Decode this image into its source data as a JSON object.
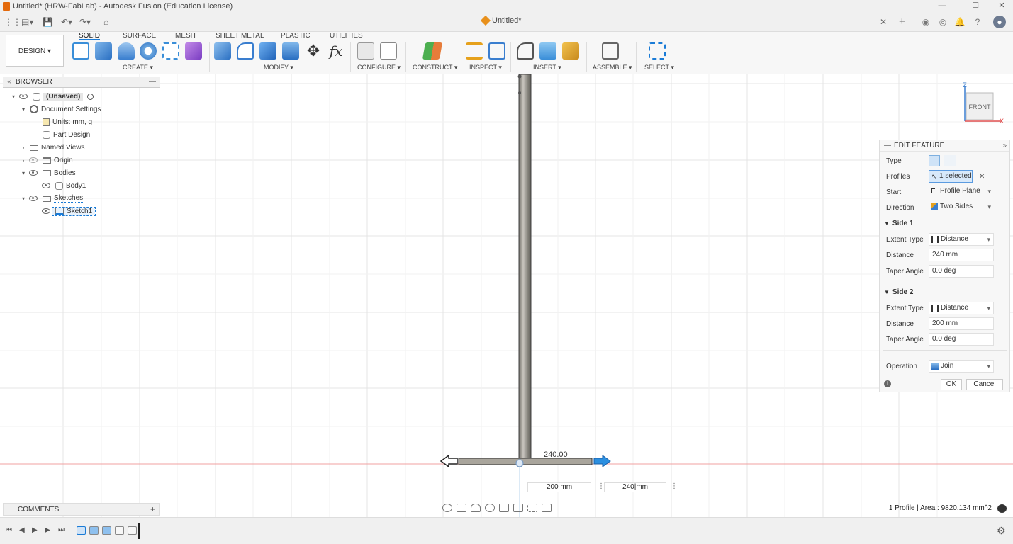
{
  "window": {
    "title": "Untitled* (HRW-FabLab) - Autodesk Fusion (Education License)",
    "doc_tab": "Untitled*"
  },
  "toolbar": {
    "design_label": "DESIGN",
    "tabs": [
      "SOLID",
      "SURFACE",
      "MESH",
      "SHEET METAL",
      "PLASTIC",
      "UTILITIES"
    ],
    "groups": [
      "CREATE",
      "MODIFY",
      "CONFIGURE",
      "CONSTRUCT",
      "INSPECT",
      "INSERT",
      "ASSEMBLE",
      "SELECT"
    ]
  },
  "browser": {
    "title": "BROWSER",
    "root": "(Unsaved)",
    "document_settings": "Document Settings",
    "units": "Units: mm, g",
    "part_design": "Part Design",
    "named_views": "Named Views",
    "origin": "Origin",
    "bodies": "Bodies",
    "body1": "Body1",
    "sketches": "Sketches",
    "sketch1": "Sketch1"
  },
  "viewcube": {
    "face": "FRONT",
    "axis_z": "Z",
    "axis_x": "X"
  },
  "panel": {
    "title": "EDIT FEATURE",
    "type_label": "Type",
    "profiles_label": "Profiles",
    "profiles_value": "1 selected",
    "start_label": "Start",
    "start_value": "Profile Plane",
    "direction_label": "Direction",
    "direction_value": "Two Sides",
    "side1": "Side 1",
    "side1_extent_label": "Extent Type",
    "side1_extent_value": "Distance",
    "side1_distance_label": "Distance",
    "side1_distance_value": "240 mm",
    "side1_taper_label": "Taper Angle",
    "side1_taper_value": "0.0 deg",
    "side2": "Side 2",
    "side2_extent_label": "Extent Type",
    "side2_extent_value": "Distance",
    "side2_distance_label": "Distance",
    "side2_distance_value": "200 mm",
    "side2_taper_label": "Taper Angle",
    "side2_taper_value": "0.0 deg",
    "operation_label": "Operation",
    "operation_value": "Join",
    "ok_label": "OK",
    "cancel_label": "Cancel"
  },
  "canvas": {
    "dimension_label": "240.00",
    "dim_input_left": "200 mm",
    "dim_input_right_value": "240",
    "dim_input_right_unit": "mm"
  },
  "comments": {
    "label": "COMMENTS"
  },
  "status": {
    "text": "1 Profile | Area : 9820.134 mm^2"
  },
  "colors": {
    "accent": "#1a7bd6",
    "orange": "#e3690c",
    "body_gray": "#a9a59c",
    "red_axis": "#e88",
    "blue_arrow": "#2b8fe0"
  }
}
